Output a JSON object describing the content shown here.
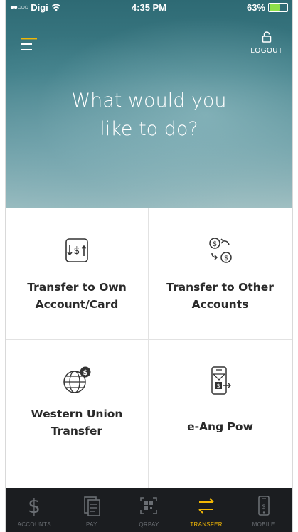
{
  "status_bar": {
    "carrier": "Digi",
    "time": "4:35 PM",
    "battery_percent": "63%",
    "battery_level": 0.63
  },
  "header": {
    "logout_label": "LOGOUT",
    "title": "What would you\nlike to do?"
  },
  "tiles": [
    {
      "label": "Transfer to Own\nAccount/Card",
      "icon": "transfer-own-icon"
    },
    {
      "label": "Transfer to Other\nAccounts",
      "icon": "transfer-other-icon"
    },
    {
      "label": "Western Union\nTransfer",
      "icon": "globe-dollar-icon"
    },
    {
      "label": "e-Ang Pow",
      "icon": "phone-envelope-icon"
    }
  ],
  "tabbar": {
    "items": [
      {
        "label": "ACCOUNTS",
        "icon": "dollar-icon"
      },
      {
        "label": "PAY",
        "icon": "bill-icon"
      },
      {
        "label": "QRPAY",
        "icon": "qr-scan-icon"
      },
      {
        "label": "TRANSFER",
        "icon": "transfer-arrows-icon"
      },
      {
        "label": "MOBILE",
        "icon": "mobile-icon"
      }
    ],
    "active_index": 3
  },
  "colors": {
    "accent": "#f2b705",
    "tabbar_bg": "#1b1d20",
    "hero_top": "#2e6a74",
    "hero_bottom": "#9fbfc2",
    "battery": "#8ee04a"
  }
}
